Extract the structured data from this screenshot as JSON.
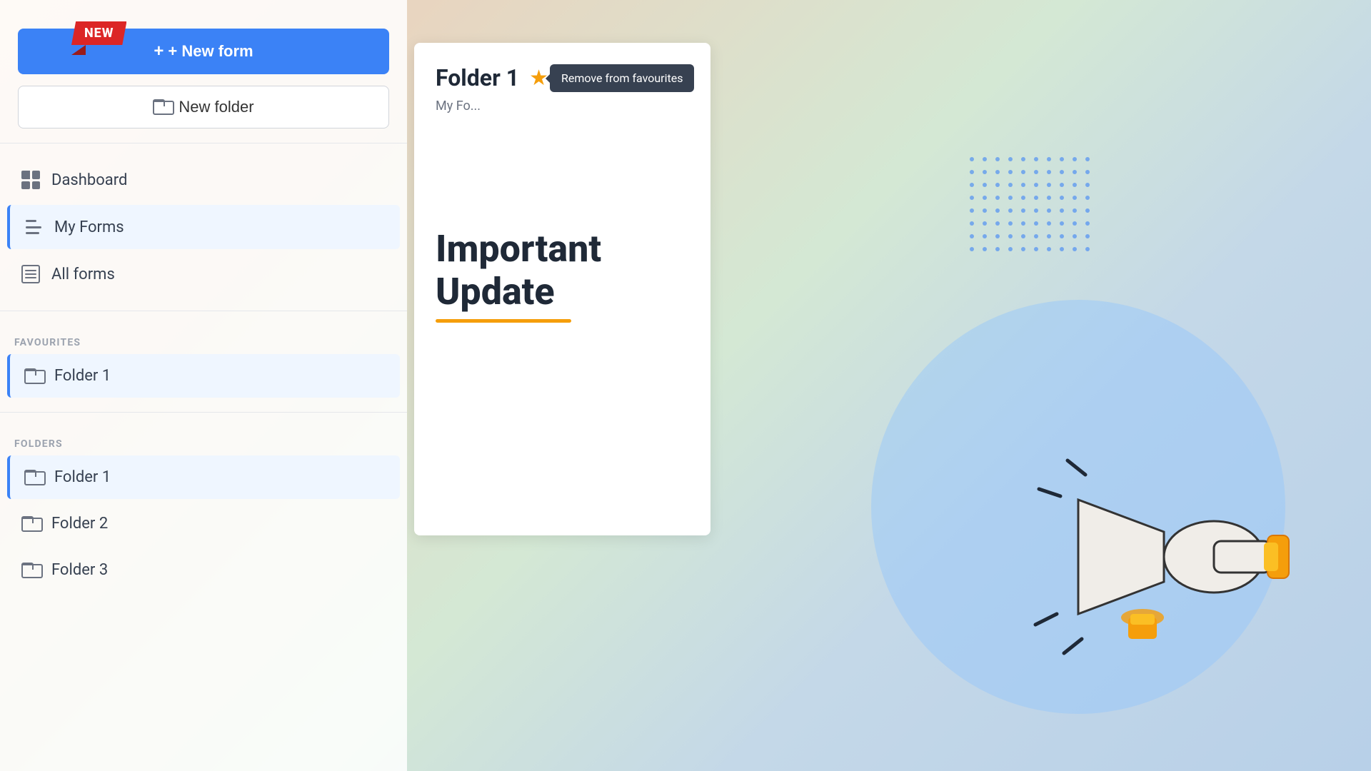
{
  "sidebar": {
    "new_badge": "NEW",
    "new_form_label": "+ New form",
    "new_folder_label": "New folder",
    "nav": {
      "dashboard_label": "Dashboard",
      "my_forms_label": "My Forms",
      "all_forms_label": "All forms"
    },
    "sections": {
      "favourites_label": "FAVOURITES",
      "folders_label": "FOLDERS"
    },
    "favourites": [
      {
        "name": "Folder 1"
      }
    ],
    "folders": [
      {
        "name": "Folder 1"
      },
      {
        "name": "Folder 2"
      },
      {
        "name": "Folder 3"
      }
    ]
  },
  "main": {
    "folder_title": "Folder 1",
    "folder_subtitle": "My Fo...",
    "tooltip_text": "Remove from favourites",
    "update_heading_line1": "Important",
    "update_heading_line2": "Update"
  },
  "colors": {
    "accent_blue": "#3b82f6",
    "star_color": "#f59e0b",
    "red_badge": "#dc2626"
  }
}
